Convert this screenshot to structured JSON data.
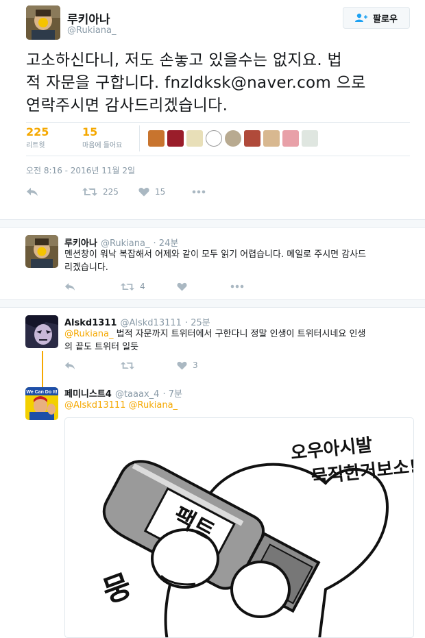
{
  "main_tweet": {
    "display_name": "루키아나",
    "handle": "@Rukiana_",
    "follow_label": "팔로우",
    "text_lines": [
      "고소하신다니, 저도 손놓고 있을수는 없지요. 법",
      "적 자문을 구합니다. fnzldksk@naver.com 으로",
      "연락주시면 감사드리겠습니다."
    ],
    "retweets_count": "225",
    "retweets_label": "리트윗",
    "likes_count": "15",
    "likes_label": "마음에 들어요",
    "timestamp": "오전 8:16 - 2016년 11월 2일",
    "actions": {
      "retweet_count": "225",
      "like_count": "15"
    }
  },
  "replies": [
    {
      "name": "루키아나",
      "handle": "@Rukiana_",
      "time": "· 24분",
      "text_lines": [
        "멘션창이 워낙 복잡해서 어제와 같이 모두 읽기 어렵습니다. 메일로 주시면 감사드",
        "리겠습니다."
      ],
      "retweet_count": "4",
      "like_count": ""
    },
    {
      "name": "Alskd1311",
      "handle": "@Alskd13111",
      "time": "· 25분",
      "mention": "@Rukiana_",
      "text_line1_rest": " 법적 자문까지 트위터에서 구한다니 정말 인생이 트위터시네요 인생",
      "text_line2": "의 끝도 트위터 일듯",
      "retweet_count": "",
      "like_count": "3"
    },
    {
      "name": "페미니스트4",
      "handle": "@taaax_4",
      "time": "· 7분",
      "mentions": "@Alskd13111 @Rukiana_",
      "media_texts": {
        "shout_line1": "오우아시발",
        "shout_line2": "묵직한거보소!",
        "bottle_label": "팩트",
        "sfx": "뭉"
      }
    }
  ],
  "colors": {
    "accent": "#f5a800",
    "muted": "#8899a6",
    "border": "#e1e8ed",
    "text": "#14171a"
  }
}
